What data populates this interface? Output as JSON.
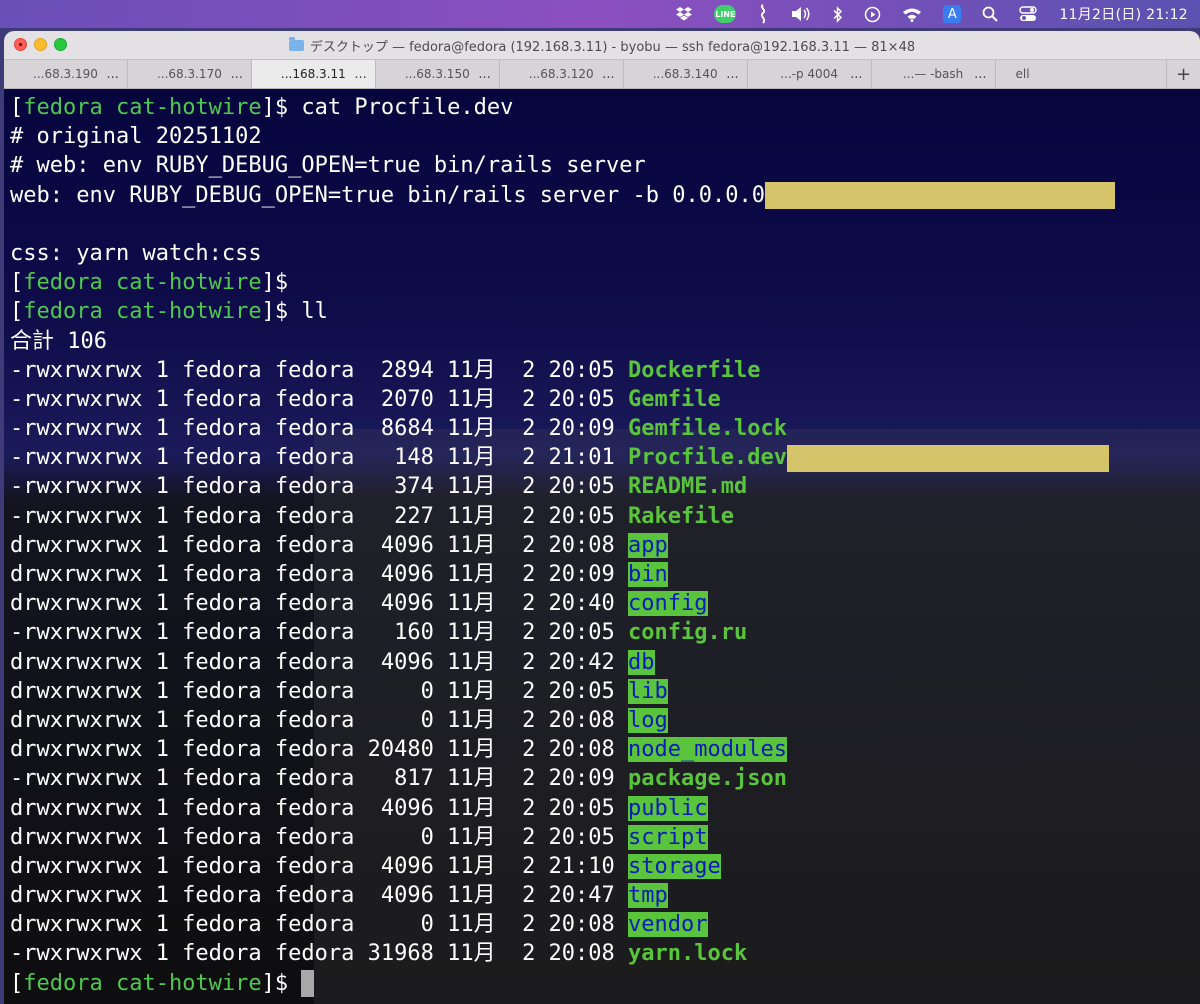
{
  "menubar": {
    "clock": "11月2日(日) 21:12",
    "line_label": "LINE",
    "input_label": "A",
    "icons": [
      "dropbox-icon",
      "line-icon",
      "script-icon",
      "volume-icon",
      "bluetooth-icon",
      "play-icon",
      "wifi-icon",
      "input-source-icon",
      "search-icon",
      "control-center-icon"
    ]
  },
  "window": {
    "title": "デスクトップ — fedora@fedora (192.168.3.11) - byobu — ssh fedora@192.168.3.11 — 81×48"
  },
  "tabs": [
    {
      "label": "...68.3.190",
      "active": false
    },
    {
      "label": "...68.3.170",
      "active": false
    },
    {
      "label": "...168.3.11",
      "active": true
    },
    {
      "label": "...68.3.150",
      "active": false
    },
    {
      "label": "...68.3.120",
      "active": false
    },
    {
      "label": "...68.3.140",
      "active": false
    },
    {
      "label": "...-p 4004",
      "active": false
    },
    {
      "label": "...— -bash",
      "active": false
    },
    {
      "label": "ell",
      "active": false
    }
  ],
  "new_tab_label": "+",
  "tab_dots": "...",
  "colors": {
    "prompt_host": "#4fc84f",
    "file_name": "#59c43c",
    "dir_fg": "#0b1bb5",
    "dir_bg": "#59c43c",
    "highlight": "#d5c469",
    "terminal_bg": "#06053d"
  },
  "terminal": {
    "prompt": {
      "open": "[",
      "host": "fedora cat-hotwire",
      "close": "]$ "
    },
    "cmd1": "cat Procfile.dev",
    "procfile": [
      "# original 20251102",
      "# web: env RUBY_DEBUG_OPEN=true bin/rails server",
      "web: env RUBY_DEBUG_OPEN=true bin/rails server -b 0.0.0.0",
      "",
      "css: yarn watch:css"
    ],
    "cmd2": "ll",
    "total": "合計 106",
    "listing": [
      {
        "meta": "-rwxrwxrwx 1 fedora fedora  2894 11月  2 20:05 ",
        "name": "Dockerfile",
        "type": "file"
      },
      {
        "meta": "-rwxrwxrwx 1 fedora fedora  2070 11月  2 20:05 ",
        "name": "Gemfile",
        "type": "file"
      },
      {
        "meta": "-rwxrwxrwx 1 fedora fedora  8684 11月  2 20:09 ",
        "name": "Gemfile.lock",
        "type": "file"
      },
      {
        "meta": "-rwxrwxrwx 1 fedora fedora   148 11月  2 21:01 ",
        "name": "Procfile.dev",
        "type": "file"
      },
      {
        "meta": "-rwxrwxrwx 1 fedora fedora   374 11月  2 20:05 ",
        "name": "README.md",
        "type": "file"
      },
      {
        "meta": "-rwxrwxrwx 1 fedora fedora   227 11月  2 20:05 ",
        "name": "Rakefile",
        "type": "file"
      },
      {
        "meta": "drwxrwxrwx 1 fedora fedora  4096 11月  2 20:08 ",
        "name": "app",
        "type": "dir"
      },
      {
        "meta": "drwxrwxrwx 1 fedora fedora  4096 11月  2 20:09 ",
        "name": "bin",
        "type": "dir"
      },
      {
        "meta": "drwxrwxrwx 1 fedora fedora  4096 11月  2 20:40 ",
        "name": "config",
        "type": "dir"
      },
      {
        "meta": "-rwxrwxrwx 1 fedora fedora   160 11月  2 20:05 ",
        "name": "config.ru",
        "type": "file"
      },
      {
        "meta": "drwxrwxrwx 1 fedora fedora  4096 11月  2 20:42 ",
        "name": "db",
        "type": "dir"
      },
      {
        "meta": "drwxrwxrwx 1 fedora fedora     0 11月  2 20:05 ",
        "name": "lib",
        "type": "dir"
      },
      {
        "meta": "drwxrwxrwx 1 fedora fedora     0 11月  2 20:08 ",
        "name": "log",
        "type": "dir"
      },
      {
        "meta": "drwxrwxrwx 1 fedora fedora 20480 11月  2 20:08 ",
        "name": "node_modules",
        "type": "dir"
      },
      {
        "meta": "-rwxrwxrwx 1 fedora fedora   817 11月  2 20:09 ",
        "name": "package.json",
        "type": "file"
      },
      {
        "meta": "drwxrwxrwx 1 fedora fedora  4096 11月  2 20:05 ",
        "name": "public",
        "type": "dir"
      },
      {
        "meta": "drwxrwxrwx 1 fedora fedora     0 11月  2 20:05 ",
        "name": "script",
        "type": "dir"
      },
      {
        "meta": "drwxrwxrwx 1 fedora fedora  4096 11月  2 21:10 ",
        "name": "storage",
        "type": "dir"
      },
      {
        "meta": "drwxrwxrwx 1 fedora fedora  4096 11月  2 20:47 ",
        "name": "tmp",
        "type": "dir"
      },
      {
        "meta": "drwxrwxrwx 1 fedora fedora     0 11月  2 20:08 ",
        "name": "vendor",
        "type": "dir"
      },
      {
        "meta": "-rwxrwxrwx 1 fedora fedora 31968 11月  2 20:08 ",
        "name": "yarn.lock",
        "type": "file"
      }
    ]
  }
}
